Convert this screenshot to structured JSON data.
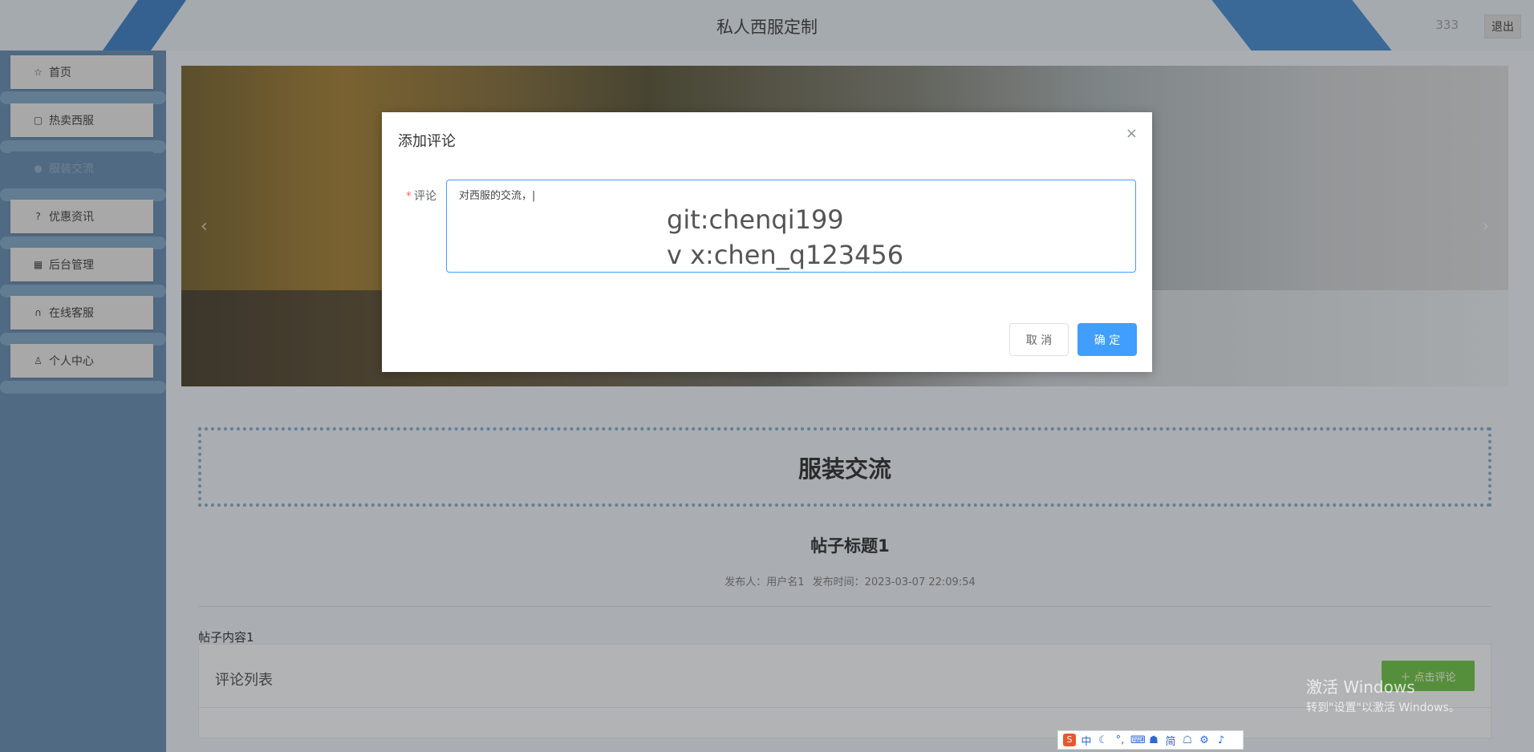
{
  "header": {
    "title": "私人西服定制",
    "username": "333",
    "logout_label": "退出"
  },
  "sidebar": {
    "items": [
      {
        "label": "首页",
        "icon": "star-icon"
      },
      {
        "label": "热卖西服",
        "icon": "shopping-bag-icon"
      },
      {
        "label": "服装交流",
        "icon": "chat-icon"
      },
      {
        "label": "优惠资讯",
        "icon": "question-icon"
      },
      {
        "label": "后台管理",
        "icon": "building-icon"
      },
      {
        "label": "在线客服",
        "icon": "headset-icon"
      },
      {
        "label": "个人中心",
        "icon": "user-icon"
      }
    ],
    "active_index": 2
  },
  "banner": {
    "prev_icon": "‹",
    "next_icon": "›"
  },
  "page": {
    "section_title": "服装交流",
    "post_title": "帖子标题1",
    "meta_author": "发布人：用户名1",
    "meta_time": "发布时间：2023-03-07 22:09:54",
    "post_content": "帖子内容1",
    "comment_list_label": "评论列表",
    "add_comment_label": "＋ 点击评论"
  },
  "modal": {
    "title": "添加评论",
    "close_icon": "×",
    "field_label": "评论",
    "required_mark": "*",
    "textarea_value": "对西服的交流，|",
    "cancel_label": "取 消",
    "confirm_label": "确 定"
  },
  "overlay": {
    "line1": "git:chenqi199",
    "line2": "v x:chen_q123456"
  },
  "watermark": {
    "line1": "激活 Windows",
    "line2": "转到\"设置\"以激活 Windows。"
  },
  "ime_toolbar": {
    "logo": "S",
    "items": [
      "中",
      "☾",
      "°,",
      "⌨",
      "☗",
      "简",
      "☖",
      "⚙",
      "♪"
    ]
  }
}
